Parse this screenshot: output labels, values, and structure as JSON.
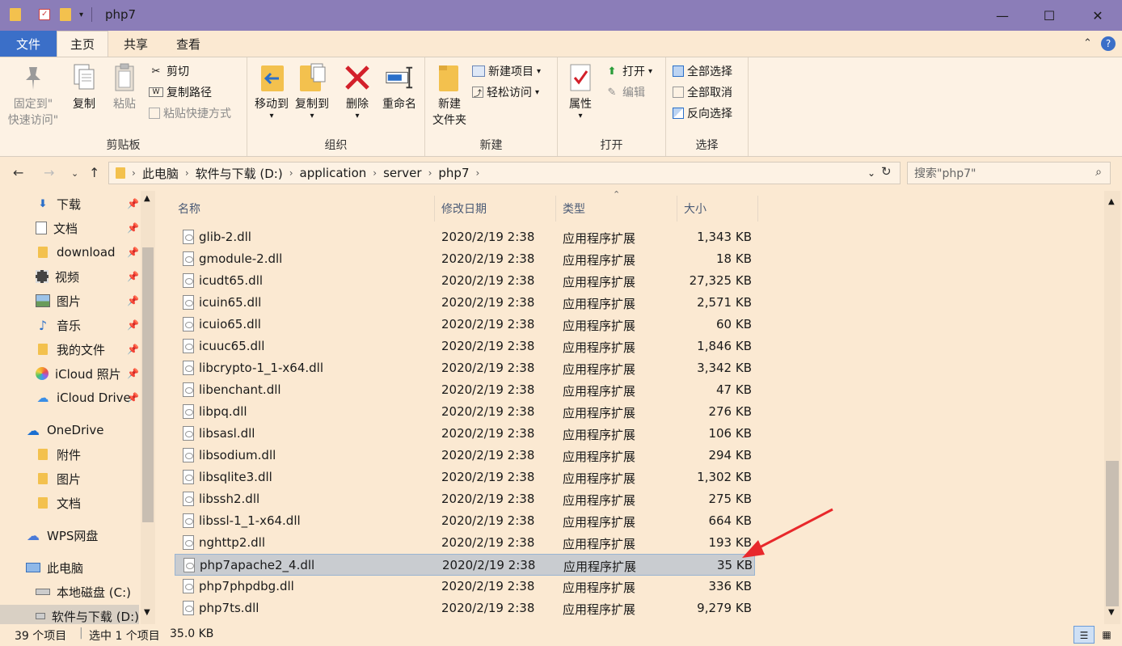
{
  "window": {
    "title": "php7",
    "minimize": "—",
    "maximize": "☐",
    "close": "✕"
  },
  "tabs": {
    "file": "文件",
    "home": "主页",
    "share": "共享",
    "view": "查看"
  },
  "ribbon": {
    "clipboard": {
      "label": "剪贴板",
      "pin": "固定到\"\n快速访问\"",
      "pin_line1": "固定到\"",
      "pin_line2": "快速访问\"",
      "copy": "复制",
      "paste": "粘贴",
      "cut": "剪切",
      "copy_path": "复制路径",
      "paste_shortcut": "粘贴快捷方式"
    },
    "organize": {
      "label": "组织",
      "move_to": "移动到",
      "copy_to": "复制到",
      "delete": "删除",
      "rename": "重命名"
    },
    "new": {
      "label": "新建",
      "new_folder_line1": "新建",
      "new_folder_line2": "文件夹",
      "new_item": "新建项目",
      "easy_access": "轻松访问"
    },
    "open": {
      "label": "打开",
      "properties": "属性",
      "open": "打开",
      "edit": "编辑"
    },
    "select": {
      "label": "选择",
      "select_all": "全部选择",
      "select_none": "全部取消",
      "invert": "反向选择"
    }
  },
  "address": {
    "crumbs": [
      "此电脑",
      "软件与下载 (D:)",
      "application",
      "server",
      "php7"
    ],
    "search_placeholder": "搜索\"php7\""
  },
  "nav": {
    "items": [
      {
        "label": "下载",
        "icon": "download-arrow-icon",
        "pinned": true
      },
      {
        "label": "文档",
        "icon": "document-icon",
        "pinned": true
      },
      {
        "label": "download",
        "icon": "folder-icon",
        "pinned": true
      },
      {
        "label": "视频",
        "icon": "video-icon",
        "pinned": true
      },
      {
        "label": "图片",
        "icon": "picture-icon",
        "pinned": true
      },
      {
        "label": "音乐",
        "icon": "music-icon",
        "pinned": true
      },
      {
        "label": "我的文件",
        "icon": "folder-icon",
        "pinned": true
      },
      {
        "label": "iCloud 照片",
        "icon": "icloud-photos-icon",
        "pinned": true
      },
      {
        "label": "iCloud Drive",
        "icon": "icloud-drive-icon",
        "pinned": true
      },
      {
        "label": "OneDrive",
        "icon": "onedrive-icon",
        "pinned": false
      },
      {
        "label": "附件",
        "icon": "folder-icon",
        "pinned": false
      },
      {
        "label": "图片",
        "icon": "folder-icon",
        "pinned": false
      },
      {
        "label": "文档",
        "icon": "folder-icon",
        "pinned": false
      },
      {
        "label": "WPS网盘",
        "icon": "wps-cloud-icon",
        "pinned": false
      },
      {
        "label": "此电脑",
        "icon": "computer-icon",
        "pinned": false
      },
      {
        "label": "本地磁盘 (C:)",
        "icon": "drive-icon",
        "pinned": false
      },
      {
        "label": "软件与下载 (D:)",
        "icon": "drive-icon",
        "pinned": false
      }
    ]
  },
  "columns": {
    "name": "名称",
    "date": "修改日期",
    "type": "类型",
    "size": "大小"
  },
  "files": [
    {
      "name": "glib-2.dll",
      "date": "2020/2/19 2:38",
      "type": "应用程序扩展",
      "size": "1,343 KB"
    },
    {
      "name": "gmodule-2.dll",
      "date": "2020/2/19 2:38",
      "type": "应用程序扩展",
      "size": "18 KB"
    },
    {
      "name": "icudt65.dll",
      "date": "2020/2/19 2:38",
      "type": "应用程序扩展",
      "size": "27,325 KB"
    },
    {
      "name": "icuin65.dll",
      "date": "2020/2/19 2:38",
      "type": "应用程序扩展",
      "size": "2,571 KB"
    },
    {
      "name": "icuio65.dll",
      "date": "2020/2/19 2:38",
      "type": "应用程序扩展",
      "size": "60 KB"
    },
    {
      "name": "icuuc65.dll",
      "date": "2020/2/19 2:38",
      "type": "应用程序扩展",
      "size": "1,846 KB"
    },
    {
      "name": "libcrypto-1_1-x64.dll",
      "date": "2020/2/19 2:38",
      "type": "应用程序扩展",
      "size": "3,342 KB"
    },
    {
      "name": "libenchant.dll",
      "date": "2020/2/19 2:38",
      "type": "应用程序扩展",
      "size": "47 KB"
    },
    {
      "name": "libpq.dll",
      "date": "2020/2/19 2:38",
      "type": "应用程序扩展",
      "size": "276 KB"
    },
    {
      "name": "libsasl.dll",
      "date": "2020/2/19 2:38",
      "type": "应用程序扩展",
      "size": "106 KB"
    },
    {
      "name": "libsodium.dll",
      "date": "2020/2/19 2:38",
      "type": "应用程序扩展",
      "size": "294 KB"
    },
    {
      "name": "libsqlite3.dll",
      "date": "2020/2/19 2:38",
      "type": "应用程序扩展",
      "size": "1,302 KB"
    },
    {
      "name": "libssh2.dll",
      "date": "2020/2/19 2:38",
      "type": "应用程序扩展",
      "size": "275 KB"
    },
    {
      "name": "libssl-1_1-x64.dll",
      "date": "2020/2/19 2:38",
      "type": "应用程序扩展",
      "size": "664 KB"
    },
    {
      "name": "nghttp2.dll",
      "date": "2020/2/19 2:38",
      "type": "应用程序扩展",
      "size": "193 KB"
    },
    {
      "name": "php7apache2_4.dll",
      "date": "2020/2/19 2:38",
      "type": "应用程序扩展",
      "size": "35 KB",
      "selected": true
    },
    {
      "name": "php7phpdbg.dll",
      "date": "2020/2/19 2:38",
      "type": "应用程序扩展",
      "size": "336 KB"
    },
    {
      "name": "php7ts.dll",
      "date": "2020/2/19 2:38",
      "type": "应用程序扩展",
      "size": "9,279 KB"
    }
  ],
  "status": {
    "count": "39 个项目",
    "selected": "选中 1 个项目",
    "selected_size": "35.0 KB"
  },
  "colors": {
    "titlebar": "#8b7db8",
    "file_tab": "#3b6fc8",
    "background": "#fbe9d2",
    "annotation_arrow": "#e8282b"
  }
}
